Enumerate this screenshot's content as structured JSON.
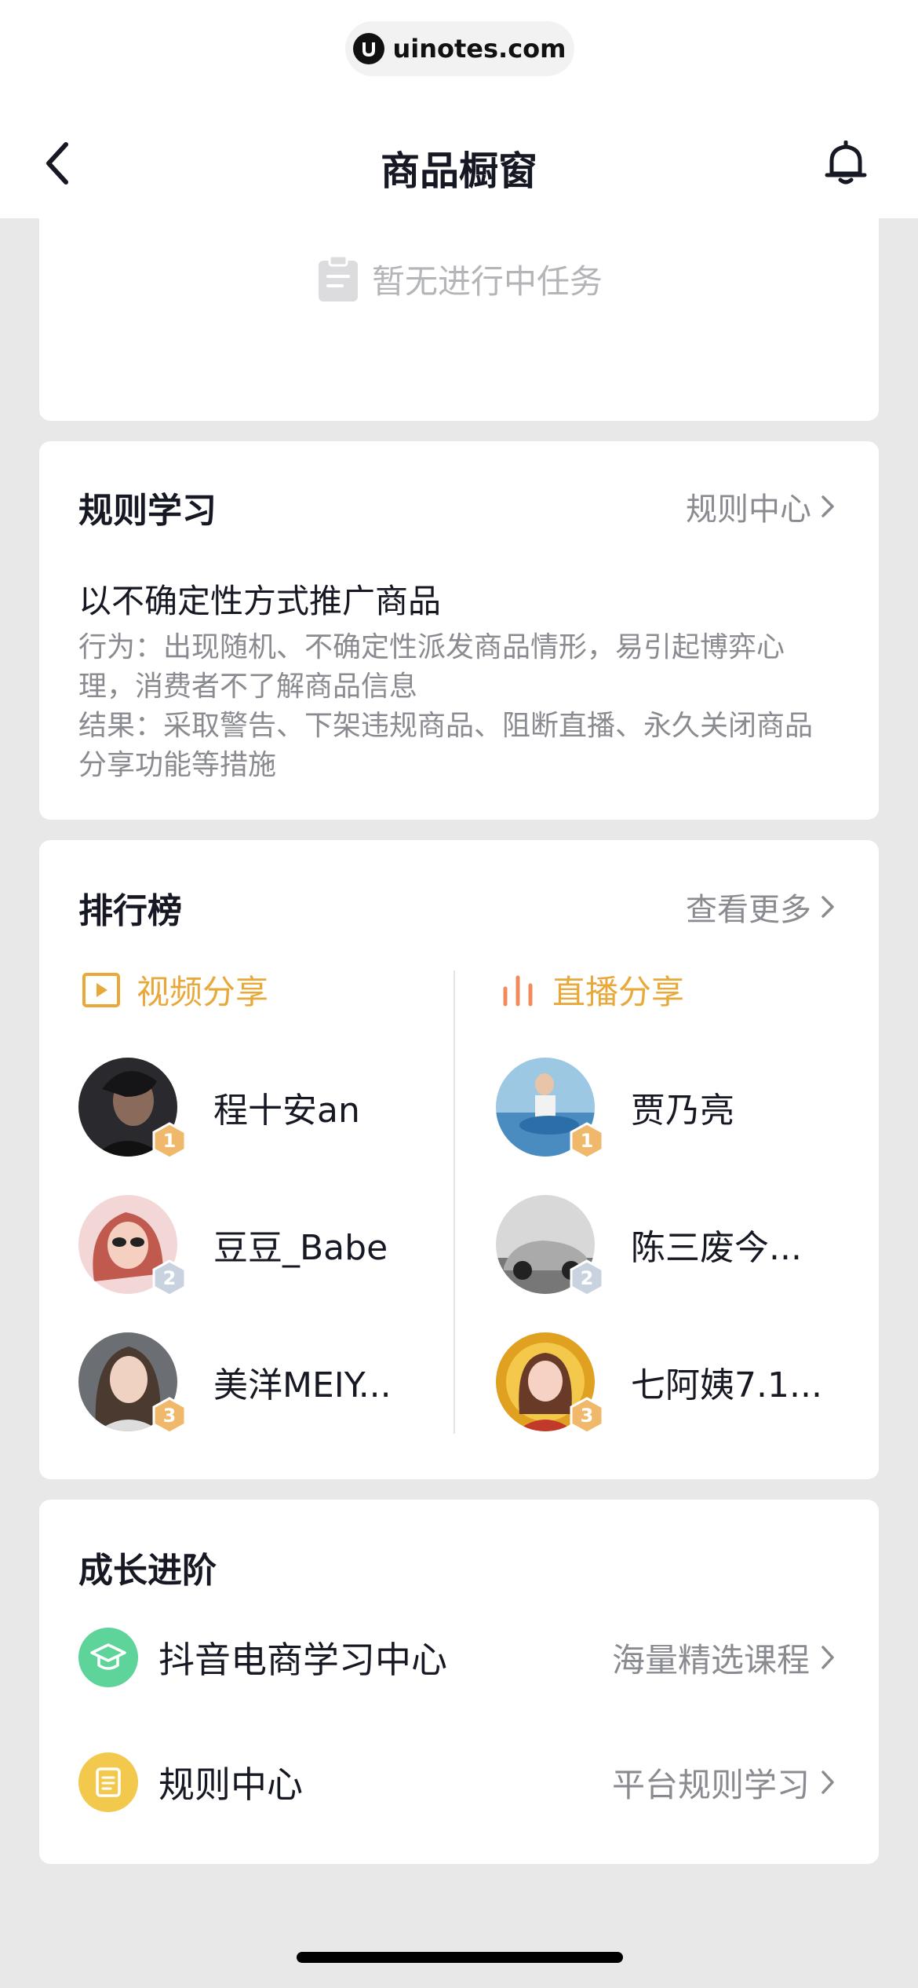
{
  "header": {
    "url": "uinotes.com",
    "title": "商品橱窗"
  },
  "task": {
    "empty_text": "暂无进行中任务"
  },
  "rules": {
    "title": "规则学习",
    "link": "规则中心",
    "item_title": "以不确定性方式推广商品",
    "behavior": "行为：出现随机、不确定性派发商品情形，易引起博弈心理，消费者不了解商品信息",
    "result": "结果：采取警告、下架违规商品、阻断直播、永久关闭商品分享功能等措施"
  },
  "ranking": {
    "title": "排行榜",
    "link": "查看更多",
    "video_label": "视频分享",
    "live_label": "直播分享",
    "video": [
      {
        "rank": "1",
        "name": "程十安an"
      },
      {
        "rank": "2",
        "name": "豆豆_Babe"
      },
      {
        "rank": "3",
        "name": "美洋MEIY..."
      }
    ],
    "live": [
      {
        "rank": "1",
        "name": "贾乃亮"
      },
      {
        "rank": "2",
        "name": "陈三废今..."
      },
      {
        "rank": "3",
        "name": "七阿姨7.1..."
      }
    ]
  },
  "growth": {
    "title": "成长进阶",
    "items": [
      {
        "label": "抖音电商学习中心",
        "sub": "海量精选课程",
        "icon": "graduation-cap-icon",
        "color": "#5fd49a"
      },
      {
        "label": "规则中心",
        "sub": "平台规则学习",
        "icon": "document-icon",
        "color": "#f2c94c"
      }
    ]
  },
  "colors": {
    "accent_gold": "#e8a93a",
    "live_orange": "#f08b5b",
    "gold_badge": "#f0b86a",
    "silver_badge": "#c9d3e0"
  }
}
